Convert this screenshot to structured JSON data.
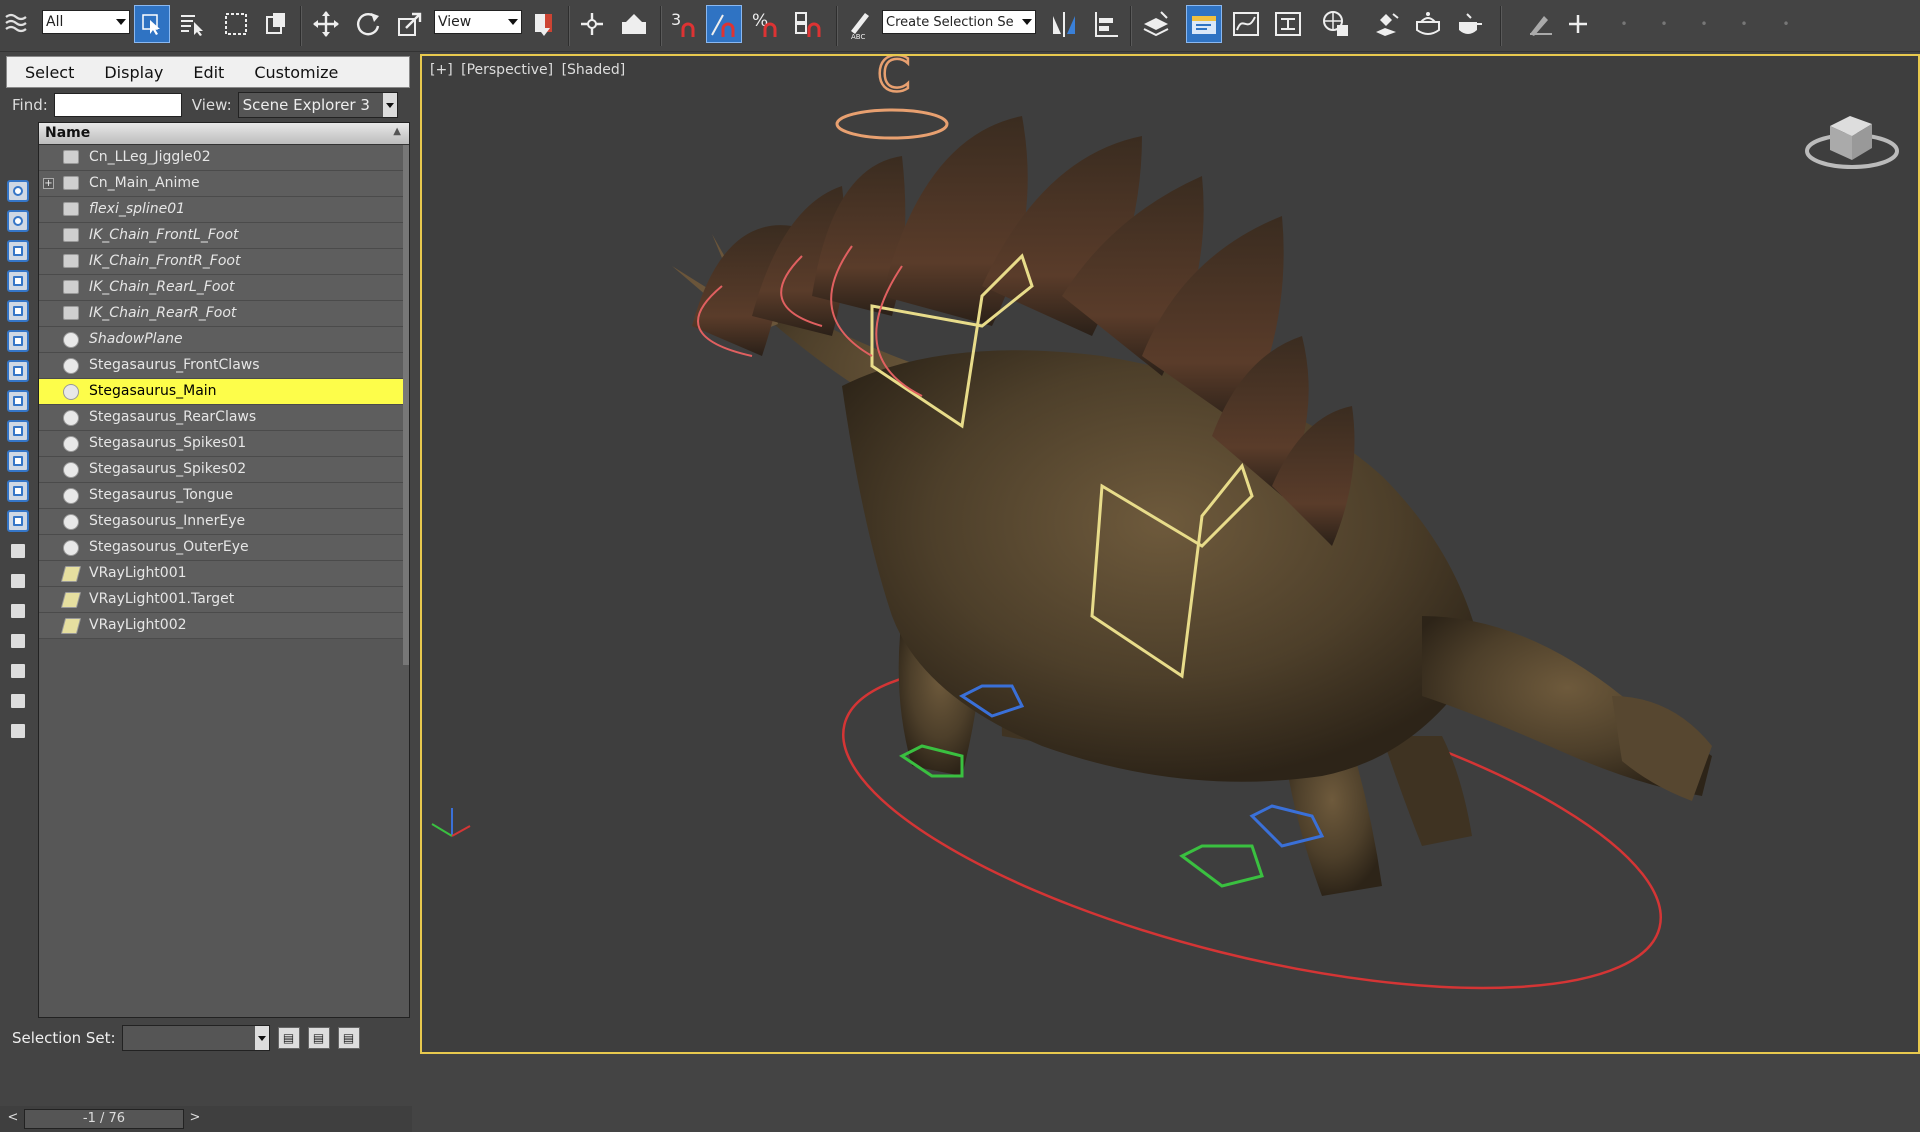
{
  "toolbar": {
    "selection_filter": "All",
    "ref_coord": "View",
    "named_selection_placeholder": "Create Selection Se"
  },
  "explorer": {
    "menus": [
      "Select",
      "Display",
      "Edit",
      "Customize"
    ],
    "find_label": "Find:",
    "find_value": "",
    "view_label": "View:",
    "view_value": "Scene Explorer 3",
    "column_name": "Name",
    "rows": [
      {
        "label": "Cn_LLeg_Jiggle02",
        "icon": "helper-icon",
        "italic": false,
        "expand": false
      },
      {
        "label": "Cn_Main_Anime",
        "icon": "helper-icon",
        "italic": false,
        "expand": true
      },
      {
        "label": "flexi_spline01",
        "icon": "helper-icon",
        "italic": true,
        "expand": false
      },
      {
        "label": "IK_Chain_FrontL_Foot",
        "icon": "ik-chain-icon",
        "italic": true,
        "expand": false
      },
      {
        "label": "IK_Chain_FrontR_Foot",
        "icon": "ik-chain-icon",
        "italic": true,
        "expand": false
      },
      {
        "label": "IK_Chain_RearL_Foot",
        "icon": "ik-chain-icon",
        "italic": true,
        "expand": false
      },
      {
        "label": "IK_Chain_RearR_Foot",
        "icon": "ik-chain-icon",
        "italic": true,
        "expand": false
      },
      {
        "label": "ShadowPlane",
        "icon": "geometry-icon",
        "italic": true,
        "expand": false
      },
      {
        "label": "Stegasaurus_FrontClaws",
        "icon": "geometry-icon",
        "italic": false,
        "expand": false
      },
      {
        "label": "Stegasaurus_Main",
        "icon": "geometry-icon",
        "italic": false,
        "expand": false,
        "selected": true
      },
      {
        "label": "Stegasaurus_RearClaws",
        "icon": "geometry-icon",
        "italic": false,
        "expand": false
      },
      {
        "label": "Stegasaurus_Spikes01",
        "icon": "geometry-icon",
        "italic": false,
        "expand": false
      },
      {
        "label": "Stegasaurus_Spikes02",
        "icon": "geometry-icon",
        "italic": false,
        "expand": false
      },
      {
        "label": "Stegasaurus_Tongue",
        "icon": "geometry-icon",
        "italic": false,
        "expand": false
      },
      {
        "label": "Stegasourus_InnerEye",
        "icon": "geometry-icon",
        "italic": false,
        "expand": false
      },
      {
        "label": "Stegasourus_OuterEye",
        "icon": "geometry-icon",
        "italic": false,
        "expand": false
      },
      {
        "label": "VRayLight001",
        "icon": "light-icon",
        "italic": false,
        "expand": false
      },
      {
        "label": "VRayLight001.Target",
        "icon": "light-icon",
        "italic": false,
        "expand": false
      },
      {
        "label": "VRayLight002",
        "icon": "light-icon",
        "italic": false,
        "expand": false
      }
    ],
    "selection_set_label": "Selection Set:",
    "selection_set_value": ""
  },
  "timeline": {
    "prev": "<",
    "frame": "-1 / 76",
    "next": ">"
  },
  "viewport": {
    "labels": [
      "[+]",
      "[Perspective]",
      "[Shaded]"
    ],
    "active_border_color": "#e8c94e"
  },
  "colors": {
    "selected_row": "#fdfd4a",
    "active_tool": "#2f73c3"
  }
}
